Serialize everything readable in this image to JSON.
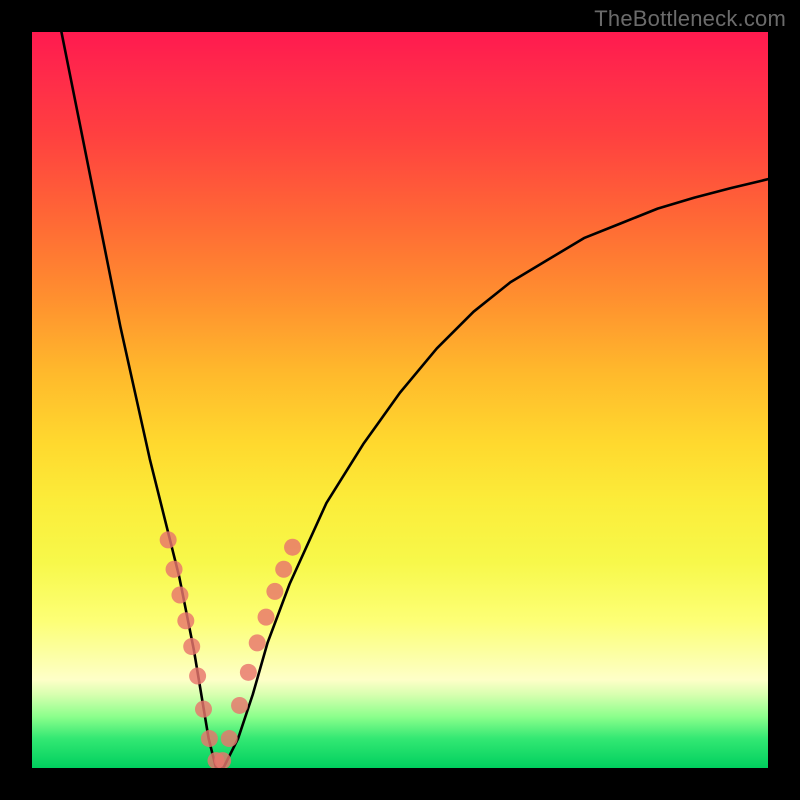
{
  "watermark": "TheBottleneck.com",
  "chart_data": {
    "type": "line",
    "title": "",
    "xlabel": "",
    "ylabel": "",
    "xlim": [
      0,
      100
    ],
    "ylim": [
      0,
      100
    ],
    "grid": false,
    "legend": false,
    "series": [
      {
        "name": "curve",
        "color": "#000000",
        "x": [
          4,
          6,
          8,
          10,
          12,
          14,
          16,
          18,
          20,
          22,
          23,
          24,
          25,
          26,
          28,
          30,
          32,
          35,
          40,
          45,
          50,
          55,
          60,
          65,
          70,
          75,
          80,
          85,
          90,
          95,
          100
        ],
        "y": [
          100,
          90,
          80,
          70,
          60,
          51,
          42,
          34,
          26,
          16,
          10,
          4,
          0,
          0,
          4,
          10,
          17,
          25,
          36,
          44,
          51,
          57,
          62,
          66,
          69,
          72,
          74,
          76,
          77.5,
          78.8,
          80
        ]
      },
      {
        "name": "markers",
        "color": "#e8756c",
        "type": "scatter",
        "x": [
          18.5,
          19.3,
          20.1,
          20.9,
          21.7,
          22.5,
          23.3,
          24.1,
          25.0,
          25.9,
          26.8,
          28.2,
          29.4,
          30.6,
          31.8,
          33.0,
          34.2,
          35.4
        ],
        "y": [
          31.0,
          27.0,
          23.5,
          20.0,
          16.5,
          12.5,
          8.0,
          4.0,
          1.0,
          1.0,
          4.0,
          8.5,
          13.0,
          17.0,
          20.5,
          24.0,
          27.0,
          30.0
        ]
      }
    ],
    "background_gradient": {
      "direction": "vertical",
      "stops": [
        {
          "pos": 0.0,
          "color": "#ff1a4f"
        },
        {
          "pos": 0.5,
          "color": "#ffcd2d"
        },
        {
          "pos": 0.8,
          "color": "#fdff76"
        },
        {
          "pos": 1.0,
          "color": "#00cf5e"
        }
      ]
    }
  }
}
